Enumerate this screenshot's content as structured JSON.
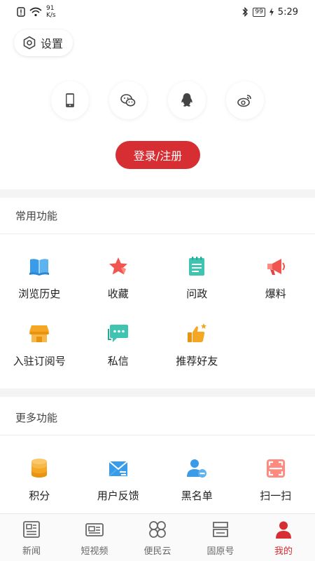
{
  "status_bar": {
    "speed_value": "91",
    "speed_unit": "K/s",
    "battery": "99",
    "time": "5:29"
  },
  "settings": {
    "label": "设置"
  },
  "login": {
    "button_label": "登录/注册",
    "icons": [
      "phone-icon",
      "wechat-icon",
      "qq-icon",
      "weibo-icon"
    ]
  },
  "common": {
    "title": "常用功能",
    "items": [
      {
        "label": "浏览历史",
        "icon": "book-icon"
      },
      {
        "label": "收藏",
        "icon": "star-icon"
      },
      {
        "label": "问政",
        "icon": "notepad-icon"
      },
      {
        "label": "爆料",
        "icon": "megaphone-icon"
      },
      {
        "label": "入驻订阅号",
        "icon": "store-icon"
      },
      {
        "label": "私信",
        "icon": "chat-icon"
      },
      {
        "label": "推荐好友",
        "icon": "thumbs-up-icon"
      }
    ]
  },
  "more": {
    "title": "更多功能",
    "items": [
      {
        "label": "积分",
        "icon": "coins-icon"
      },
      {
        "label": "用户反馈",
        "icon": "mail-icon"
      },
      {
        "label": "黑名单",
        "icon": "block-user-icon"
      },
      {
        "label": "扫一扫",
        "icon": "scan-icon"
      }
    ]
  },
  "nav": {
    "items": [
      {
        "label": "新闻",
        "icon": "news-icon"
      },
      {
        "label": "短视频",
        "icon": "video-icon"
      },
      {
        "label": "便民云",
        "icon": "clover-icon"
      },
      {
        "label": "固原号",
        "icon": "bookmark-stack-icon"
      },
      {
        "label": "我的",
        "icon": "user-icon"
      }
    ],
    "active_index": 4
  },
  "colors": {
    "accent": "#d62e33",
    "blue": "#3a9be8",
    "red": "#f0554f",
    "teal": "#3ec4b0",
    "orange": "#f5a623"
  }
}
